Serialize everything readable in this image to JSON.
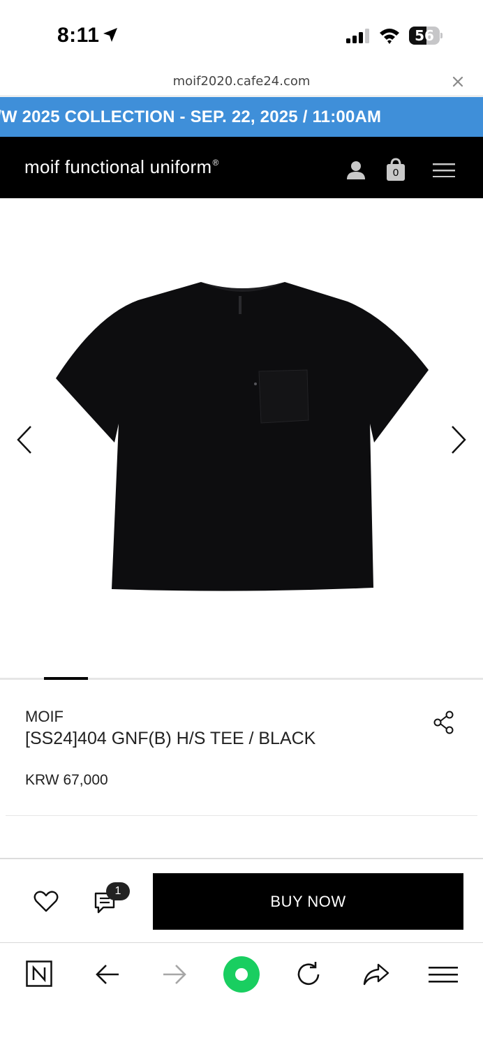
{
  "status_bar": {
    "time": "8:11",
    "battery_level": "56",
    "location_icon": "location-arrow-icon",
    "signal_icon": "cellular-signal-icon",
    "wifi_icon": "wifi-icon"
  },
  "browser": {
    "url": "moif2020.cafe24.com",
    "close_icon": "close-icon",
    "toolbar_icons": [
      "naver-n-icon",
      "back-arrow-icon",
      "forward-arrow-icon",
      "green-home-icon",
      "reload-icon",
      "share-icon",
      "menu-icon"
    ]
  },
  "banner": {
    "text": "/W 2025 COLLECTION - SEP. 22, 2025 / 11:00AM",
    "color": "#3f8fd9"
  },
  "header": {
    "logo_text": "moif functional uniform",
    "logo_mark": "®",
    "cart_count": "0",
    "icons": [
      "user-icon",
      "shopping-bag-icon",
      "hamburger-menu-icon"
    ]
  },
  "gallery": {
    "image_subject": "black short sleeve t-shirt with chest pocket",
    "prev_icon": "chevron-left-icon",
    "next_icon": "chevron-right-icon",
    "current_slide_fraction": 0.09
  },
  "product": {
    "brand": "MOIF",
    "name": "[SS24]404 GNF(B) H/S TEE / BLACK",
    "price": "KRW 67,000"
  },
  "actions": {
    "review_count": "1",
    "buy_label": "BUY NOW",
    "icons": [
      "heart-icon",
      "review-icon"
    ]
  },
  "colors": {
    "header_bg": "#000000",
    "accent_green": "#19ce60"
  }
}
